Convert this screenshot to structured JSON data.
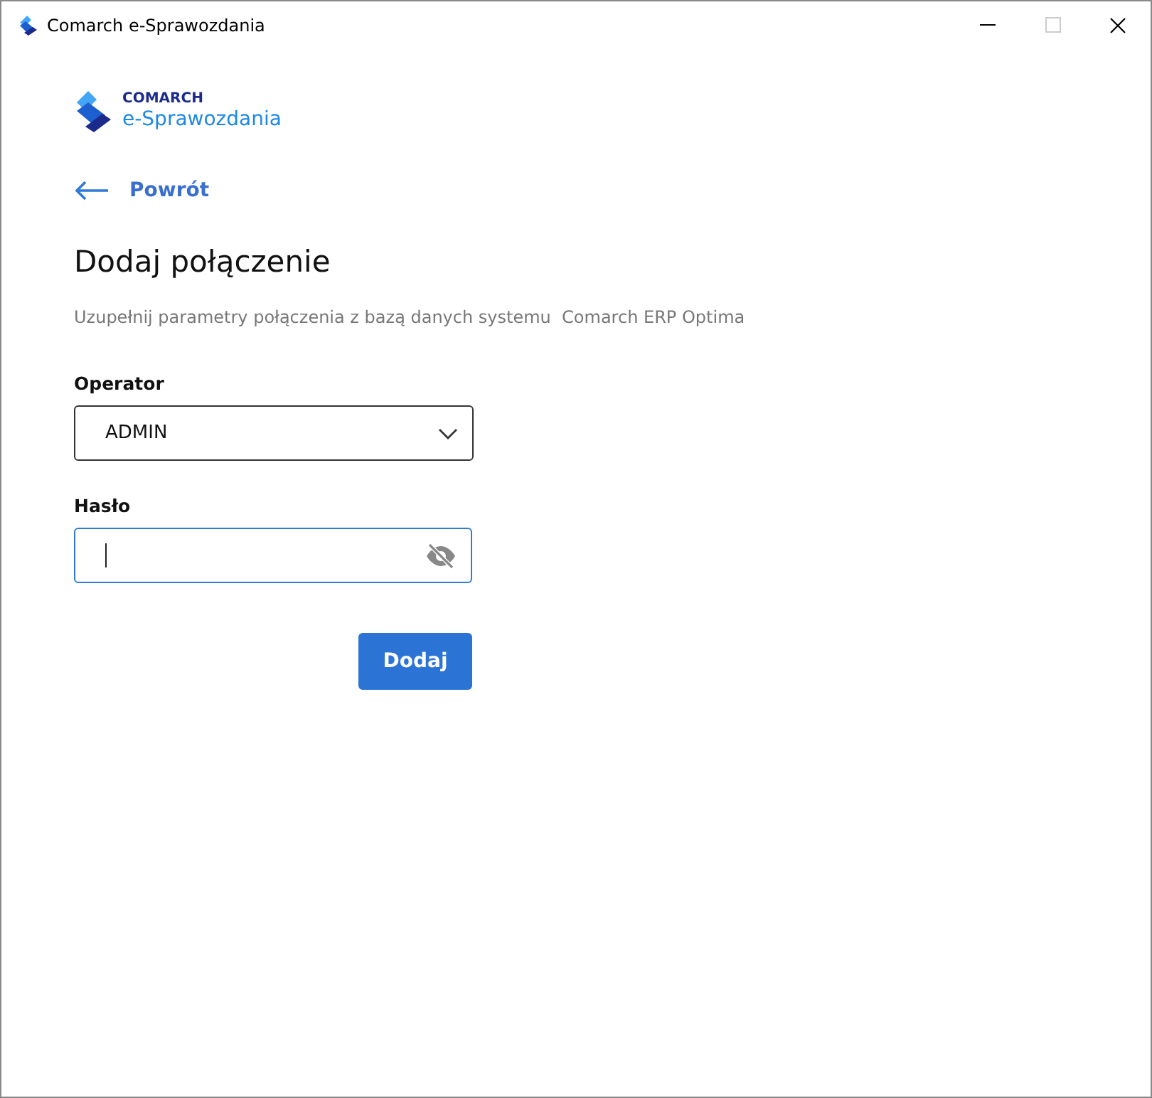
{
  "window": {
    "title": "Comarch e-Sprawozdania"
  },
  "logo": {
    "brand": "COMARCH",
    "product": "e-Sprawozdania"
  },
  "back_link": {
    "label": "Powrót"
  },
  "heading": "Dodaj połączenie",
  "description": "Uzupełnij parametry połączenia z bazą danych systemu  Comarch ERP Optima",
  "fields": [
    {
      "kind": "select",
      "label": "Operator",
      "value": "ADMIN",
      "focused": false
    },
    {
      "kind": "password",
      "label": "Hasło",
      "focused": true
    }
  ],
  "buttons": [
    {
      "label": "Dodaj"
    }
  ]
}
